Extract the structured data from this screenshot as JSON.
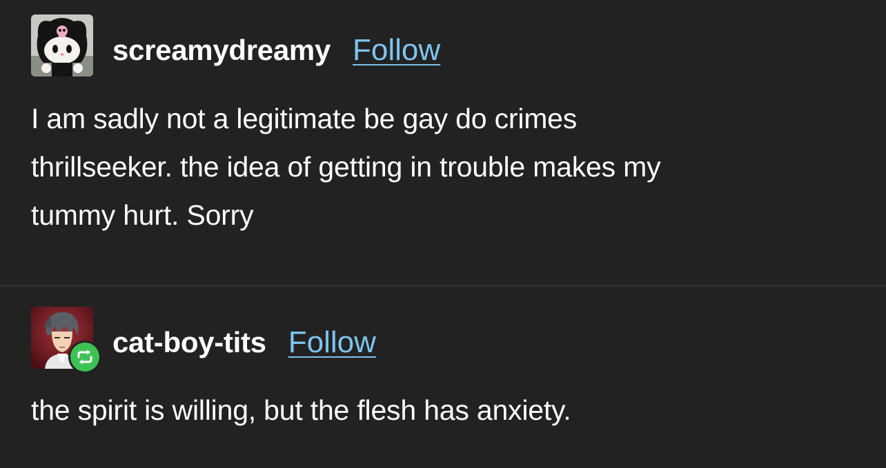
{
  "posts": [
    {
      "username": "screamydreamy",
      "follow_label": "Follow",
      "text_lines": [
        "I am sadly not a legitimate be gay do crimes",
        "thrillseeker. the idea of getting in trouble makes my",
        "tummy hurt. Sorry"
      ],
      "avatar_icon": "plush-toy-avatar-icon"
    },
    {
      "username": "cat-boy-tits",
      "follow_label": "Follow",
      "text_lines": [
        "the spirit is willing, but the flesh has anxiety."
      ],
      "avatar_icon": "anime-character-avatar-icon",
      "badge_icon": "reblog-icon"
    }
  ],
  "colors": {
    "background": "#222222",
    "text": "#ffffff",
    "link": "#7fc4ee",
    "reblog_badge": "#3fc255",
    "divider": "#444444"
  }
}
